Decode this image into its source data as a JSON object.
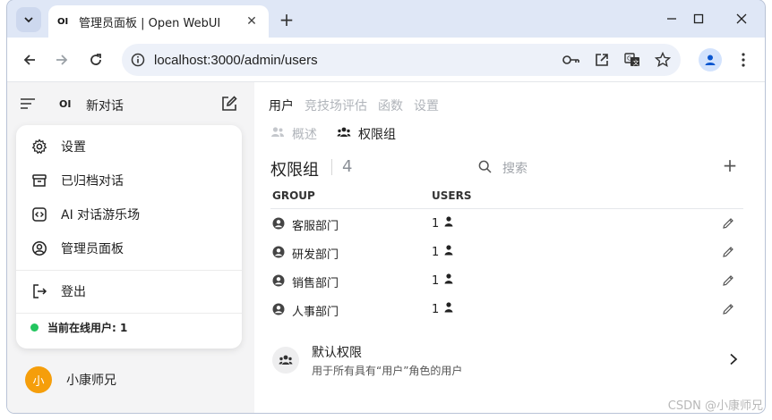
{
  "browser": {
    "tab_title": "管理员面板 | Open WebUI",
    "tab_favicon": "OI",
    "url": "localhost:3000/admin/users",
    "icons": [
      "tab-list-icon",
      "close-icon",
      "plus-icon",
      "minimize-icon",
      "maximize-icon",
      "window-close-icon",
      "back-icon",
      "forward-icon",
      "reload-icon",
      "site-info-icon",
      "key-icon",
      "open-in-app-icon",
      "translate-icon",
      "star-icon",
      "profile-icon",
      "more-vert-icon"
    ]
  },
  "sidebar": {
    "logo": "OI",
    "new_chat": "新对话",
    "menu": {
      "settings": "设置",
      "archived": "已归档对话",
      "playground": "AI 对话游乐场",
      "admin": "管理员面板",
      "logout": "登出",
      "online_users": "当前在线用户: 1"
    },
    "user": {
      "avatar_text": "小",
      "name": "小康师兄"
    }
  },
  "main": {
    "top_tabs": [
      {
        "label": "用户",
        "active": true
      },
      {
        "label": "竞技场评估",
        "active": false
      },
      {
        "label": "函数",
        "active": false
      },
      {
        "label": "设置",
        "active": false
      }
    ],
    "sub_tabs": [
      {
        "label": "概述",
        "active": false
      },
      {
        "label": "权限组",
        "active": true
      }
    ],
    "section_title": "权限组",
    "section_count": "4",
    "search_placeholder": "搜索",
    "table": {
      "headers": {
        "group": "GROUP",
        "users": "USERS"
      },
      "rows": [
        {
          "group": "客服部门",
          "users": "1"
        },
        {
          "group": "研发部门",
          "users": "1"
        },
        {
          "group": "销售部门",
          "users": "1"
        },
        {
          "group": "人事部门",
          "users": "1"
        }
      ]
    },
    "default_permissions": {
      "title": "默认权限",
      "description": "用于所有具有“用户”角色的用户"
    }
  },
  "watermark": "CSDN @小康师兄",
  "colors": {
    "online": "#22c55e",
    "avatar": "#f59e0b",
    "tabstrip": "#dfe7f6"
  }
}
